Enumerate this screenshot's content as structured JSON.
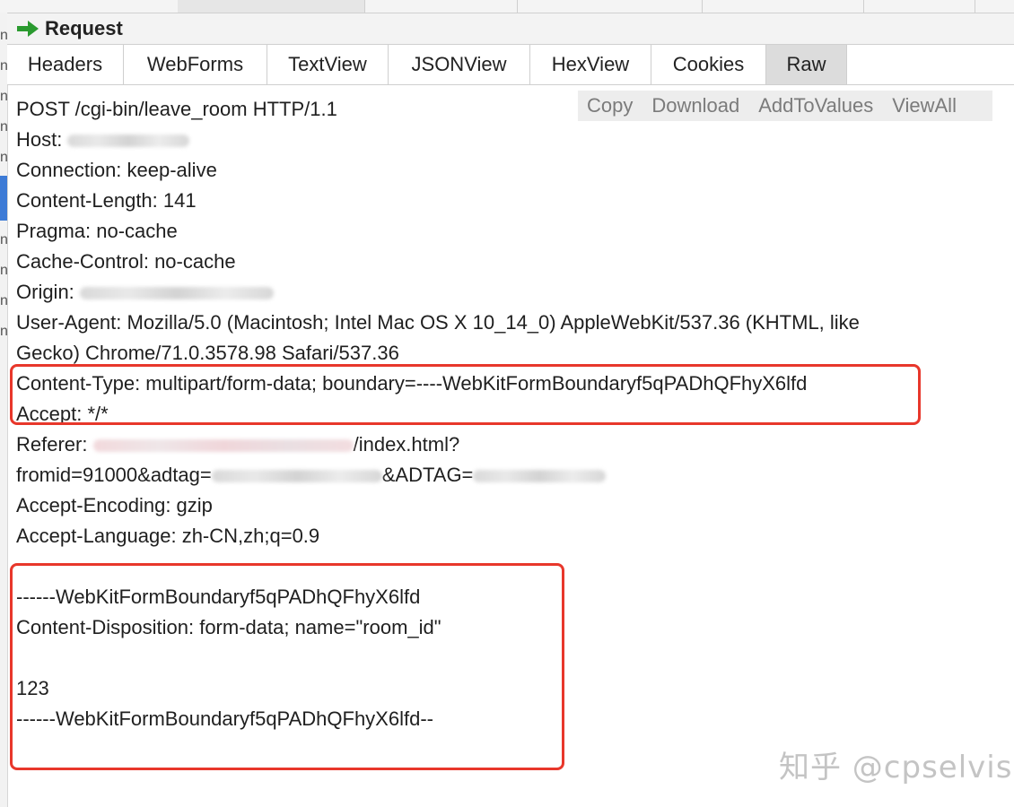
{
  "request_section": {
    "title": "Request",
    "icon": "green-right-arrow-icon",
    "icon_color": "#2a9a2f"
  },
  "tabs": [
    "Headers",
    "WebForms",
    "TextView",
    "JSONView",
    "HexView",
    "Cookies",
    "Raw"
  ],
  "active_tab": "Raw",
  "actions": [
    "Copy",
    "Download",
    "AddToValues",
    "ViewAll"
  ],
  "raw": {
    "request_line": "POST /cgi-bin/leave_room HTTP/1.1",
    "host_label": "Host: ",
    "connection": "Connection: keep-alive",
    "content_length": "Content-Length: 141",
    "pragma": "Pragma: no-cache",
    "cache_control": "Cache-Control: no-cache",
    "origin_label": "Origin: ",
    "user_agent_1": "User-Agent: Mozilla/5.0 (Macintosh; Intel Mac OS X 10_14_0) AppleWebKit/537.36 (KHTML, like",
    "user_agent_2": "Gecko) Chrome/71.0.3578.98 Safari/537.36",
    "content_type": "Content-Type: multipart/form-data; boundary=----WebKitFormBoundaryf5qPADhQFhyX6lfd",
    "accept": "Accept: */*",
    "referer_label": "Referer: ",
    "referer_tail": "/index.html?",
    "fromid": "fromid=91000&adtag=",
    "adtag2": "&ADTAG=",
    "accept_encoding": "Accept-Encoding: gzip",
    "accept_language": "Accept-Language: zh-CN,zh;q=0.9",
    "boundary_start": "------WebKitFormBoundaryf5qPADhQFhyX6lfd",
    "content_disposition": "Content-Disposition: form-data; name=\"room_id\"",
    "value": "123",
    "boundary_end": "------WebKitFormBoundaryf5qPADhQFhyX6lfd--"
  },
  "highlight_color": "#e8372b",
  "watermark": "知乎 @cpselvis"
}
